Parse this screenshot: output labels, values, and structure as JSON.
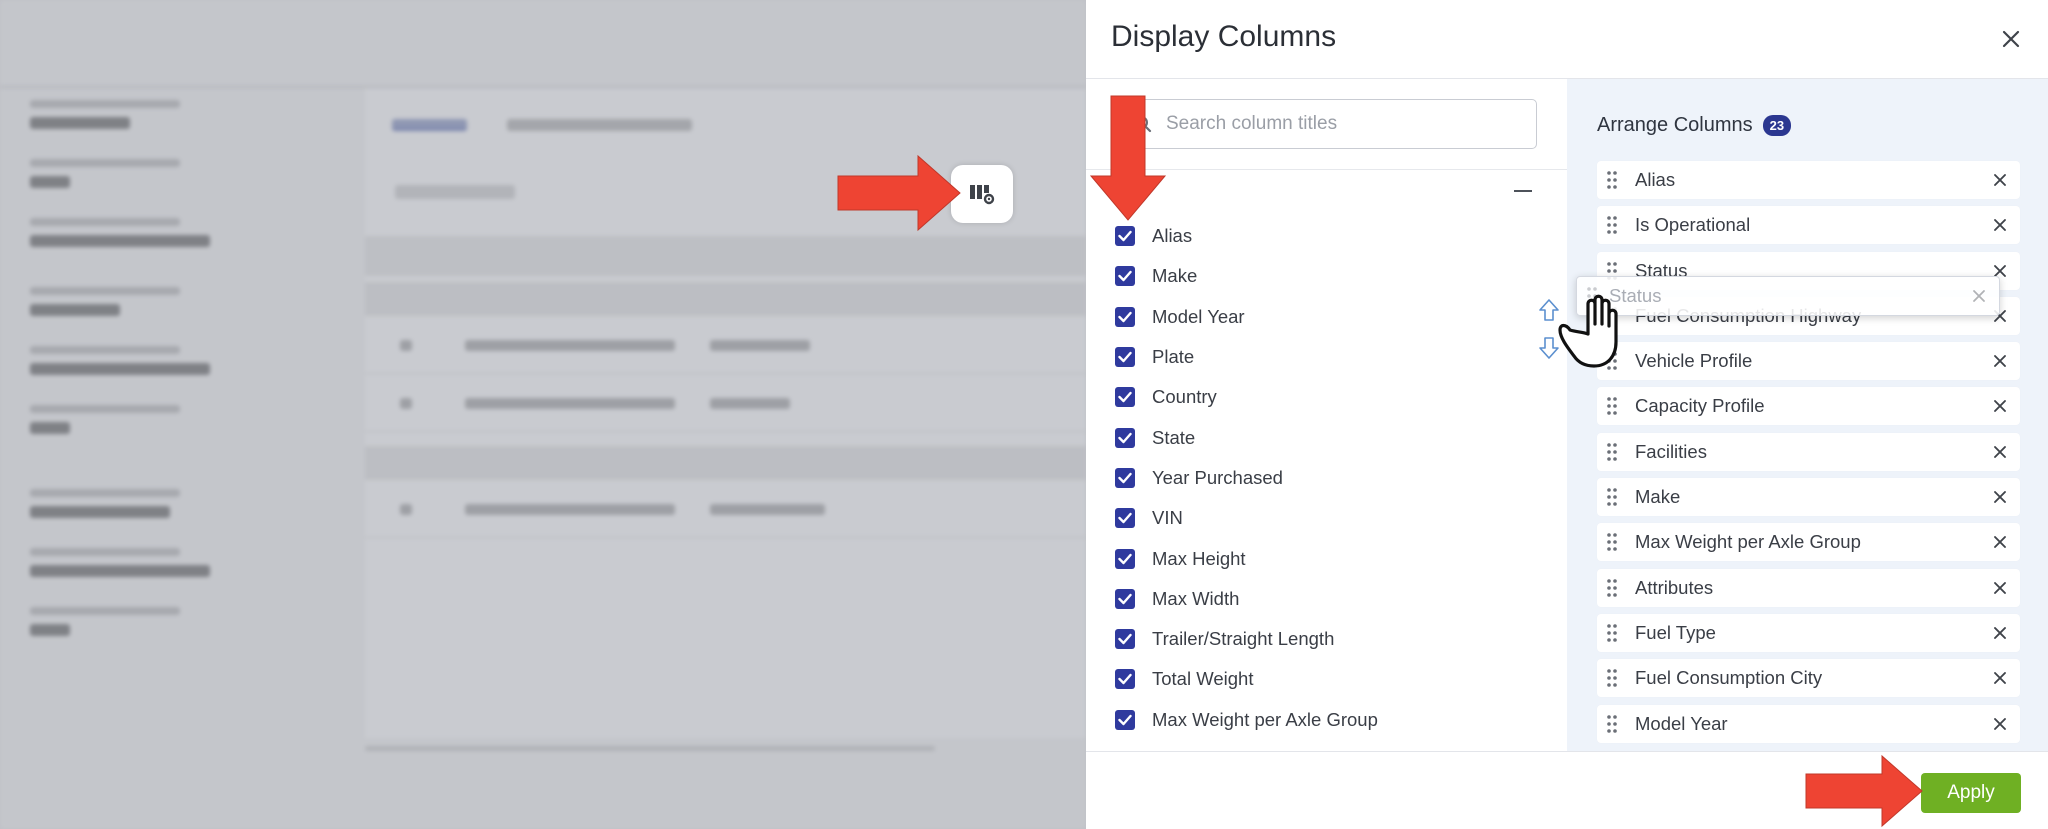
{
  "colors": {
    "accent": "#2f3a9e",
    "apply_green": "#6fb023",
    "annotation_red": "#ee4433",
    "badge": "#2b3790"
  },
  "modal": {
    "title": "Display Columns",
    "close_icon": "close-icon",
    "search": {
      "placeholder": "Search column titles",
      "value": ""
    },
    "columns": [
      {
        "label": "Alias",
        "checked": true
      },
      {
        "label": "Make",
        "checked": true
      },
      {
        "label": "Model Year",
        "checked": true
      },
      {
        "label": "Plate",
        "checked": true
      },
      {
        "label": "Country",
        "checked": true
      },
      {
        "label": "State",
        "checked": true
      },
      {
        "label": "Year Purchased",
        "checked": true
      },
      {
        "label": "VIN",
        "checked": true
      },
      {
        "label": "Max Height",
        "checked": true
      },
      {
        "label": "Max Width",
        "checked": true
      },
      {
        "label": "Trailer/Straight Length",
        "checked": true
      },
      {
        "label": "Total Weight",
        "checked": true
      },
      {
        "label": "Max Weight per Axle Group",
        "checked": true
      }
    ],
    "arrange": {
      "title": "Arrange Columns",
      "count": "23",
      "items": [
        "Alias",
        "Is Operational",
        "Status",
        "Fuel Consumption Highway",
        "Vehicle Profile",
        "Capacity Profile",
        "Facilities",
        "Make",
        "Max Weight per Axle Group",
        "Attributes",
        "Fuel Type",
        "Fuel Consumption City",
        "Model Year"
      ],
      "dragging": "Status"
    },
    "apply_label": "Apply"
  }
}
